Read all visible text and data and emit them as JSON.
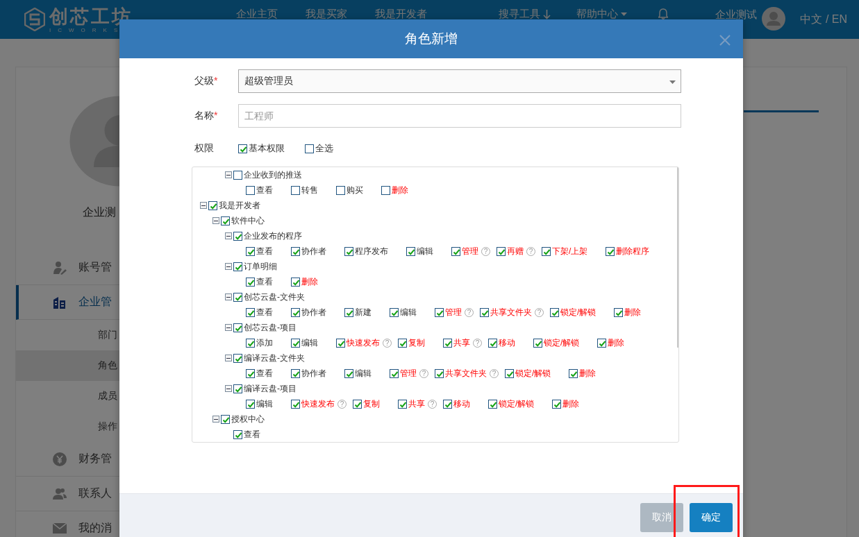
{
  "header": {
    "logo": {
      "name": "创芯工坊",
      "subtitle": "ICWORKS"
    },
    "nav": [
      {
        "label": "企业主页",
        "kind": "link"
      },
      {
        "label": "我是买家",
        "kind": "link"
      },
      {
        "label": "我是开发者",
        "kind": "link"
      },
      {
        "label": "搜寻工具",
        "kind": "download"
      },
      {
        "label": "帮助中心",
        "kind": "dropdown"
      }
    ],
    "user": "企业测试",
    "language": "中文 / EN"
  },
  "sidebar": {
    "user_name": "企业测",
    "menu": [
      {
        "label": "账号管",
        "kind": "user",
        "selected": false
      },
      {
        "label": "企业管",
        "kind": "building",
        "selected": true,
        "children": [
          {
            "label": "部门",
            "selected": false
          },
          {
            "label": "角色",
            "selected": true
          },
          {
            "label": "成员",
            "selected": false
          },
          {
            "label": "操作",
            "selected": false
          }
        ]
      },
      {
        "label": "财务管",
        "kind": "yen",
        "selected": false
      },
      {
        "label": "联系人",
        "kind": "contacts",
        "selected": false
      },
      {
        "label": "我的消",
        "kind": "mail",
        "selected": false
      }
    ]
  },
  "modal": {
    "title": "角色新增",
    "fields": [
      {
        "label": "父级",
        "required_mark": "*",
        "kind": "select",
        "value": "超级管理员"
      },
      {
        "label": "名称",
        "required_mark": "*",
        "kind": "text",
        "placeholder": "工程师"
      }
    ],
    "permissions": {
      "label": "权限",
      "options": [
        {
          "label": "基本权限",
          "checked": true
        },
        {
          "label": "全选",
          "checked": false
        }
      ],
      "tree": [
        {
          "children": [
            {
              "children": [
                {
                  "label": "企业收到的推送",
                  "checked": false,
                  "expanded": true,
                  "leaves": [
                    {
                      "label": "查看",
                      "checked": false,
                      "kind": "normal"
                    },
                    {
                      "label": "转售",
                      "checked": false,
                      "kind": "normal"
                    },
                    {
                      "label": "购买",
                      "checked": false,
                      "kind": "normal"
                    },
                    {
                      "label": "删除",
                      "checked": false,
                      "kind": "critical"
                    }
                  ]
                }
              ]
            }
          ]
        },
        {
          "label": "我是开发者",
          "checked": true,
          "expanded": true,
          "children": [
            {
              "label": "软件中心",
              "checked": true,
              "expanded": true,
              "children": [
                {
                  "label": "企业发布的程序",
                  "checked": true,
                  "expanded": true,
                  "leaves": [
                    {
                      "label": "查看",
                      "checked": true,
                      "kind": "normal"
                    },
                    {
                      "label": "协作者",
                      "checked": true,
                      "kind": "normal"
                    },
                    {
                      "label": "程序发布",
                      "checked": true,
                      "kind": "normal"
                    },
                    {
                      "label": "编辑",
                      "checked": true,
                      "kind": "normal"
                    },
                    {
                      "label": "管理",
                      "checked": true,
                      "kind": "critical",
                      "help": "?"
                    },
                    {
                      "label": "再赠",
                      "checked": true,
                      "kind": "critical",
                      "help": "?"
                    },
                    {
                      "label": "下架/上架",
                      "checked": true,
                      "kind": "critical"
                    },
                    {
                      "label": "删除程序",
                      "checked": true,
                      "kind": "critical"
                    }
                  ]
                },
                {
                  "label": "订单明细",
                  "checked": true,
                  "expanded": true,
                  "leaves": [
                    {
                      "label": "查看",
                      "checked": true,
                      "kind": "normal"
                    },
                    {
                      "label": "删除",
                      "checked": true,
                      "kind": "critical"
                    }
                  ]
                },
                {
                  "label": "创芯云盘-文件夹",
                  "checked": true,
                  "expanded": true,
                  "leaves": [
                    {
                      "label": "查看",
                      "checked": true,
                      "kind": "normal"
                    },
                    {
                      "label": "协作者",
                      "checked": true,
                      "kind": "normal"
                    },
                    {
                      "label": "新建",
                      "checked": true,
                      "kind": "normal"
                    },
                    {
                      "label": "编辑",
                      "checked": true,
                      "kind": "normal"
                    },
                    {
                      "label": "管理",
                      "checked": true,
                      "kind": "critical",
                      "help": "?"
                    },
                    {
                      "label": "共享文件夹",
                      "checked": true,
                      "kind": "critical",
                      "help": "?"
                    },
                    {
                      "label": "锁定/解锁",
                      "checked": true,
                      "kind": "critical"
                    },
                    {
                      "label": "删除",
                      "checked": true,
                      "kind": "critical"
                    }
                  ]
                },
                {
                  "label": "创芯云盘-项目",
                  "checked": true,
                  "expanded": true,
                  "leaves": [
                    {
                      "label": "添加",
                      "checked": true,
                      "kind": "normal"
                    },
                    {
                      "label": "编辑",
                      "checked": true,
                      "kind": "normal"
                    },
                    {
                      "label": "快速发布",
                      "checked": true,
                      "kind": "critical",
                      "help": "?"
                    },
                    {
                      "label": "复制",
                      "checked": true,
                      "kind": "critical"
                    },
                    {
                      "label": "共享",
                      "checked": true,
                      "kind": "critical",
                      "help": "?"
                    },
                    {
                      "label": "移动",
                      "checked": true,
                      "kind": "critical"
                    },
                    {
                      "label": "锁定/解锁",
                      "checked": true,
                      "kind": "critical"
                    },
                    {
                      "label": "删除",
                      "checked": true,
                      "kind": "critical"
                    }
                  ]
                },
                {
                  "label": "编译云盘-文件夹",
                  "checked": true,
                  "expanded": true,
                  "leaves": [
                    {
                      "label": "查看",
                      "checked": true,
                      "kind": "normal"
                    },
                    {
                      "label": "协作者",
                      "checked": true,
                      "kind": "normal"
                    },
                    {
                      "label": "编辑",
                      "checked": true,
                      "kind": "normal"
                    },
                    {
                      "label": "管理",
                      "checked": true,
                      "kind": "critical",
                      "help": "?"
                    },
                    {
                      "label": "共享文件夹",
                      "checked": true,
                      "kind": "critical",
                      "help": "?"
                    },
                    {
                      "label": "锁定/解锁",
                      "checked": true,
                      "kind": "critical"
                    },
                    {
                      "label": "删除",
                      "checked": true,
                      "kind": "critical"
                    }
                  ]
                },
                {
                  "label": "编译云盘-项目",
                  "checked": true,
                  "expanded": true,
                  "leaves": [
                    {
                      "label": "编辑",
                      "checked": true,
                      "kind": "normal"
                    },
                    {
                      "label": "快速发布",
                      "checked": true,
                      "kind": "critical",
                      "help": "?"
                    },
                    {
                      "label": "复制",
                      "checked": true,
                      "kind": "critical"
                    },
                    {
                      "label": "共享",
                      "checked": true,
                      "kind": "critical",
                      "help": "?"
                    },
                    {
                      "label": "移动",
                      "checked": true,
                      "kind": "critical"
                    },
                    {
                      "label": "锁定/解锁",
                      "checked": true,
                      "kind": "critical"
                    },
                    {
                      "label": "删除",
                      "checked": true,
                      "kind": "critical"
                    }
                  ]
                }
              ]
            },
            {
              "label": "授权中心",
              "checked": true,
              "expanded": true,
              "leaves": [
                {
                  "label": "查看",
                  "checked": true,
                  "kind": "normal"
                }
              ]
            }
          ]
        }
      ]
    },
    "buttons": [
      {
        "label": "取消",
        "kind": "secondary",
        "highlighted": false
      },
      {
        "label": "确定",
        "kind": "primary",
        "highlighted": true
      }
    ]
  }
}
